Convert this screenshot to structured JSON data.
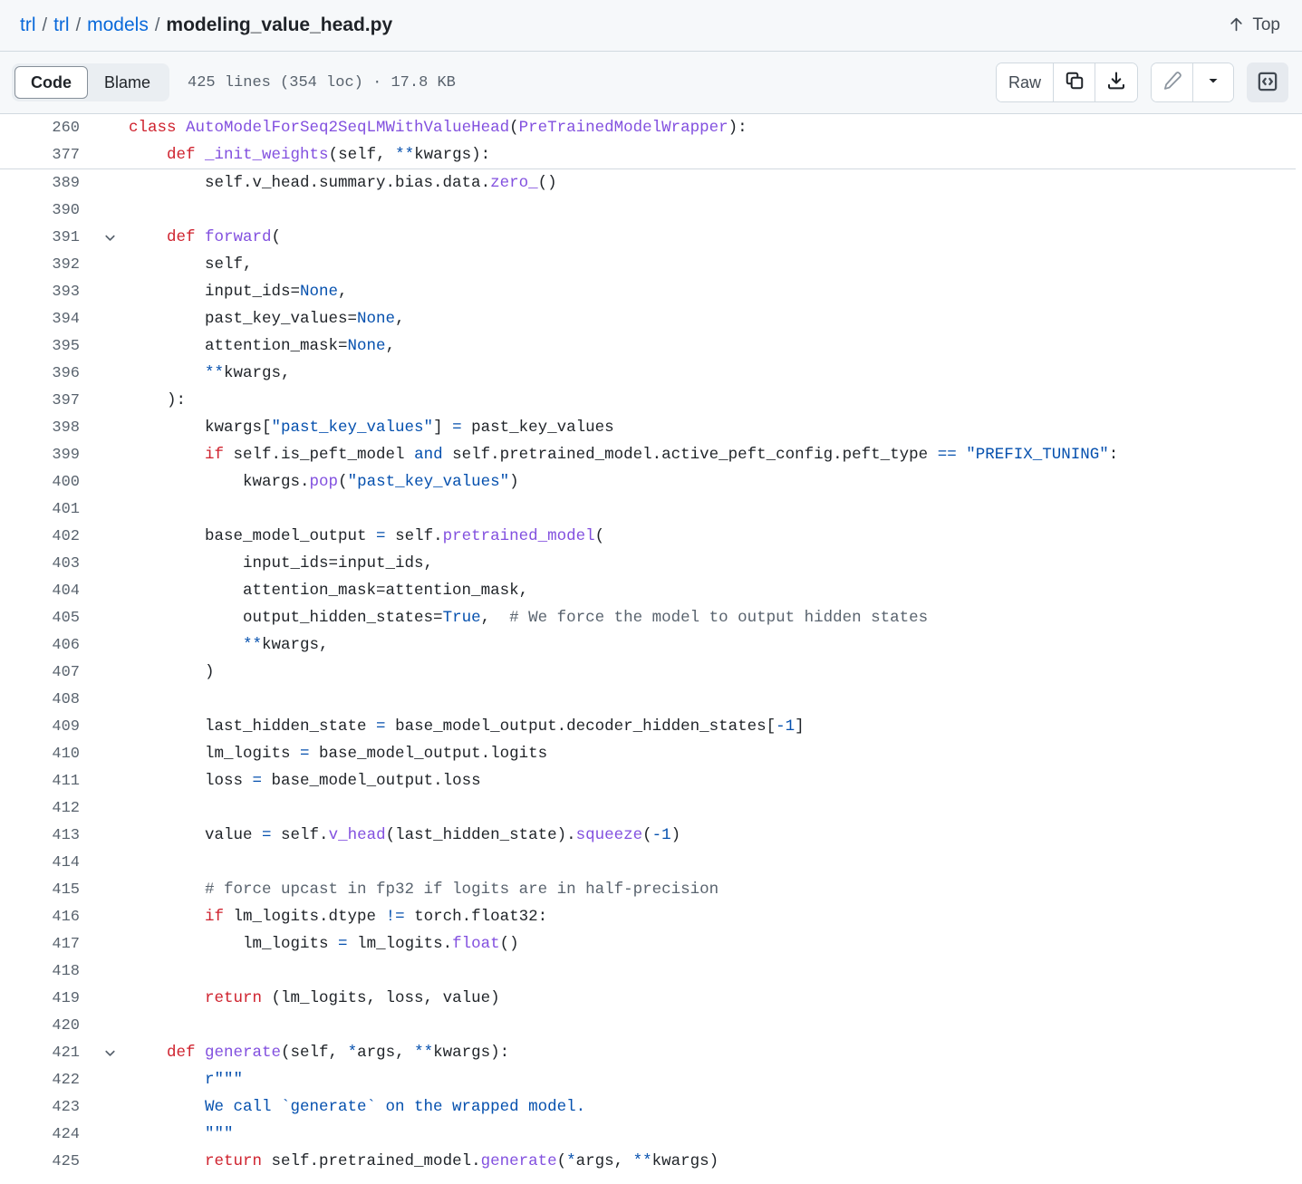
{
  "header": {
    "breadcrumb": [
      {
        "label": "trl",
        "link": true
      },
      {
        "label": "trl",
        "link": true
      },
      {
        "label": "models",
        "link": true
      },
      {
        "label": "modeling_value_head.py",
        "link": false
      }
    ],
    "separator": "/",
    "top_label": "Top",
    "top_icon": "arrow-up-icon"
  },
  "toolbar": {
    "code_tab": "Code",
    "blame_tab": "Blame",
    "active_tab": "Code",
    "file_meta": "425 lines (354 loc) · 17.8 KB",
    "raw_label": "Raw",
    "copy_icon": "copy-icon",
    "download_icon": "download-icon",
    "edit_icon": "pencil-icon",
    "caret_icon": "chevron-down-icon",
    "code_view_icon": "code-brackets-icon"
  },
  "colors": {
    "accent": "#0969da",
    "keyword": "#cf222e",
    "function": "#8250df",
    "string": "#0550ae",
    "comment": "#59636e",
    "constant": "#0550ae",
    "text": "#1f2328",
    "header_bg": "#f6f8fa",
    "border": "#d1d9e0",
    "line_number": "#59636e"
  },
  "code": {
    "sticky_lines": [
      {
        "num": "260",
        "fold": "",
        "tokens": [
          {
            "t": "class ",
            "c": "k"
          },
          {
            "t": "AutoModelForSeq2SeqLMWithValueHead",
            "c": "fn"
          },
          {
            "t": "(",
            "c": "p"
          },
          {
            "t": "PreTrainedModelWrapper",
            "c": "fn"
          },
          {
            "t": "):",
            "c": "p"
          }
        ],
        "indent": 0
      },
      {
        "num": "377",
        "fold": "",
        "tokens": [
          {
            "t": "    ",
            "c": "p"
          },
          {
            "t": "def ",
            "c": "k"
          },
          {
            "t": "_init_weights",
            "c": "fn"
          },
          {
            "t": "(self, ",
            "c": "p"
          },
          {
            "t": "**",
            "c": "o"
          },
          {
            "t": "kwargs):",
            "c": "p"
          }
        ],
        "indent": 0
      }
    ],
    "lines": [
      {
        "num": "389",
        "fold": "",
        "tokens": [
          {
            "t": "        self.v_head.summary.bias.data.",
            "c": "p"
          },
          {
            "t": "zero_",
            "c": "fn"
          },
          {
            "t": "()",
            "c": "p"
          }
        ]
      },
      {
        "num": "390",
        "fold": "",
        "tokens": []
      },
      {
        "num": "391",
        "fold": "chevron-down-icon",
        "tokens": [
          {
            "t": "    ",
            "c": "p"
          },
          {
            "t": "def ",
            "c": "k"
          },
          {
            "t": "forward",
            "c": "fn"
          },
          {
            "t": "(",
            "c": "p"
          }
        ]
      },
      {
        "num": "392",
        "fold": "",
        "tokens": [
          {
            "t": "        self,",
            "c": "p"
          }
        ]
      },
      {
        "num": "393",
        "fold": "",
        "tokens": [
          {
            "t": "        input_ids=",
            "c": "p"
          },
          {
            "t": "None",
            "c": "n"
          },
          {
            "t": ",",
            "c": "p"
          }
        ]
      },
      {
        "num": "394",
        "fold": "",
        "tokens": [
          {
            "t": "        past_key_values=",
            "c": "p"
          },
          {
            "t": "None",
            "c": "n"
          },
          {
            "t": ",",
            "c": "p"
          }
        ]
      },
      {
        "num": "395",
        "fold": "",
        "tokens": [
          {
            "t": "        attention_mask=",
            "c": "p"
          },
          {
            "t": "None",
            "c": "n"
          },
          {
            "t": ",",
            "c": "p"
          }
        ]
      },
      {
        "num": "396",
        "fold": "",
        "tokens": [
          {
            "t": "        ",
            "c": "p"
          },
          {
            "t": "**",
            "c": "o"
          },
          {
            "t": "kwargs,",
            "c": "p"
          }
        ]
      },
      {
        "num": "397",
        "fold": "",
        "tokens": [
          {
            "t": "    ):",
            "c": "p"
          }
        ]
      },
      {
        "num": "398",
        "fold": "",
        "tokens": [
          {
            "t": "        kwargs[",
            "c": "p"
          },
          {
            "t": "\"past_key_values\"",
            "c": "s"
          },
          {
            "t": "] ",
            "c": "p"
          },
          {
            "t": "=",
            "c": "o"
          },
          {
            "t": " past_key_values",
            "c": "p"
          }
        ]
      },
      {
        "num": "399",
        "fold": "",
        "tokens": [
          {
            "t": "        ",
            "c": "p"
          },
          {
            "t": "if",
            "c": "k"
          },
          {
            "t": " self.is_peft_model ",
            "c": "p"
          },
          {
            "t": "and",
            "c": "k2"
          },
          {
            "t": " self.pretrained_model.active_peft_config.peft_type ",
            "c": "p"
          },
          {
            "t": "==",
            "c": "o"
          },
          {
            "t": " ",
            "c": "p"
          },
          {
            "t": "\"PREFIX_TUNING\"",
            "c": "s"
          },
          {
            "t": ":",
            "c": "p"
          }
        ]
      },
      {
        "num": "400",
        "fold": "",
        "tokens": [
          {
            "t": "            kwargs.",
            "c": "p"
          },
          {
            "t": "pop",
            "c": "fn"
          },
          {
            "t": "(",
            "c": "p"
          },
          {
            "t": "\"past_key_values\"",
            "c": "s"
          },
          {
            "t": ")",
            "c": "p"
          }
        ]
      },
      {
        "num": "401",
        "fold": "",
        "tokens": []
      },
      {
        "num": "402",
        "fold": "",
        "tokens": [
          {
            "t": "        base_model_output ",
            "c": "p"
          },
          {
            "t": "=",
            "c": "o"
          },
          {
            "t": " self.",
            "c": "p"
          },
          {
            "t": "pretrained_model",
            "c": "fn"
          },
          {
            "t": "(",
            "c": "p"
          }
        ]
      },
      {
        "num": "403",
        "fold": "",
        "tokens": [
          {
            "t": "            input_ids=input_ids,",
            "c": "p"
          }
        ]
      },
      {
        "num": "404",
        "fold": "",
        "tokens": [
          {
            "t": "            attention_mask=attention_mask,",
            "c": "p"
          }
        ]
      },
      {
        "num": "405",
        "fold": "",
        "tokens": [
          {
            "t": "            output_hidden_states=",
            "c": "p"
          },
          {
            "t": "True",
            "c": "n"
          },
          {
            "t": ",  ",
            "c": "p"
          },
          {
            "t": "# We force the model to output hidden states",
            "c": "c"
          }
        ]
      },
      {
        "num": "406",
        "fold": "",
        "tokens": [
          {
            "t": "            ",
            "c": "p"
          },
          {
            "t": "**",
            "c": "o"
          },
          {
            "t": "kwargs,",
            "c": "p"
          }
        ]
      },
      {
        "num": "407",
        "fold": "",
        "tokens": [
          {
            "t": "        )",
            "c": "p"
          }
        ]
      },
      {
        "num": "408",
        "fold": "",
        "tokens": []
      },
      {
        "num": "409",
        "fold": "",
        "tokens": [
          {
            "t": "        last_hidden_state ",
            "c": "p"
          },
          {
            "t": "=",
            "c": "o"
          },
          {
            "t": " base_model_output.decoder_hidden_states[",
            "c": "p"
          },
          {
            "t": "-1",
            "c": "n"
          },
          {
            "t": "]",
            "c": "p"
          }
        ]
      },
      {
        "num": "410",
        "fold": "",
        "tokens": [
          {
            "t": "        lm_logits ",
            "c": "p"
          },
          {
            "t": "=",
            "c": "o"
          },
          {
            "t": " base_model_output.logits",
            "c": "p"
          }
        ]
      },
      {
        "num": "411",
        "fold": "",
        "tokens": [
          {
            "t": "        loss ",
            "c": "p"
          },
          {
            "t": "=",
            "c": "o"
          },
          {
            "t": " base_model_output.loss",
            "c": "p"
          }
        ]
      },
      {
        "num": "412",
        "fold": "",
        "tokens": []
      },
      {
        "num": "413",
        "fold": "",
        "tokens": [
          {
            "t": "        value ",
            "c": "p"
          },
          {
            "t": "=",
            "c": "o"
          },
          {
            "t": " self.",
            "c": "p"
          },
          {
            "t": "v_head",
            "c": "fn"
          },
          {
            "t": "(last_hidden_state).",
            "c": "p"
          },
          {
            "t": "squeeze",
            "c": "fn"
          },
          {
            "t": "(",
            "c": "p"
          },
          {
            "t": "-1",
            "c": "n"
          },
          {
            "t": ")",
            "c": "p"
          }
        ]
      },
      {
        "num": "414",
        "fold": "",
        "tokens": []
      },
      {
        "num": "415",
        "fold": "",
        "tokens": [
          {
            "t": "        ",
            "c": "p"
          },
          {
            "t": "# force upcast in fp32 if logits are in half-precision",
            "c": "c"
          }
        ]
      },
      {
        "num": "416",
        "fold": "",
        "tokens": [
          {
            "t": "        ",
            "c": "p"
          },
          {
            "t": "if",
            "c": "k"
          },
          {
            "t": " lm_logits.dtype ",
            "c": "p"
          },
          {
            "t": "!=",
            "c": "o"
          },
          {
            "t": " torch.float32:",
            "c": "p"
          }
        ]
      },
      {
        "num": "417",
        "fold": "",
        "tokens": [
          {
            "t": "            lm_logits ",
            "c": "p"
          },
          {
            "t": "=",
            "c": "o"
          },
          {
            "t": " lm_logits.",
            "c": "p"
          },
          {
            "t": "float",
            "c": "fn"
          },
          {
            "t": "()",
            "c": "p"
          }
        ]
      },
      {
        "num": "418",
        "fold": "",
        "tokens": []
      },
      {
        "num": "419",
        "fold": "",
        "tokens": [
          {
            "t": "        ",
            "c": "p"
          },
          {
            "t": "return",
            "c": "k"
          },
          {
            "t": " (lm_logits, loss, value)",
            "c": "p"
          }
        ]
      },
      {
        "num": "420",
        "fold": "",
        "tokens": []
      },
      {
        "num": "421",
        "fold": "chevron-down-icon",
        "tokens": [
          {
            "t": "    ",
            "c": "p"
          },
          {
            "t": "def ",
            "c": "k"
          },
          {
            "t": "generate",
            "c": "fn"
          },
          {
            "t": "(self, ",
            "c": "p"
          },
          {
            "t": "*",
            "c": "o"
          },
          {
            "t": "args, ",
            "c": "p"
          },
          {
            "t": "**",
            "c": "o"
          },
          {
            "t": "kwargs):",
            "c": "p"
          }
        ]
      },
      {
        "num": "422",
        "fold": "",
        "tokens": [
          {
            "t": "        ",
            "c": "p"
          },
          {
            "t": "r\"\"\"",
            "c": "s"
          }
        ]
      },
      {
        "num": "423",
        "fold": "",
        "tokens": [
          {
            "t": "        We call `generate` on the wrapped model.",
            "c": "s"
          }
        ]
      },
      {
        "num": "424",
        "fold": "",
        "tokens": [
          {
            "t": "        ",
            "c": "p"
          },
          {
            "t": "\"\"\"",
            "c": "s"
          }
        ]
      },
      {
        "num": "425",
        "fold": "",
        "tokens": [
          {
            "t": "        ",
            "c": "p"
          },
          {
            "t": "return",
            "c": "k"
          },
          {
            "t": " self.pretrained_model.",
            "c": "p"
          },
          {
            "t": "generate",
            "c": "fn"
          },
          {
            "t": "(",
            "c": "p"
          },
          {
            "t": "*",
            "c": "o"
          },
          {
            "t": "args, ",
            "c": "p"
          },
          {
            "t": "**",
            "c": "o"
          },
          {
            "t": "kwargs)",
            "c": "p"
          }
        ]
      }
    ]
  }
}
